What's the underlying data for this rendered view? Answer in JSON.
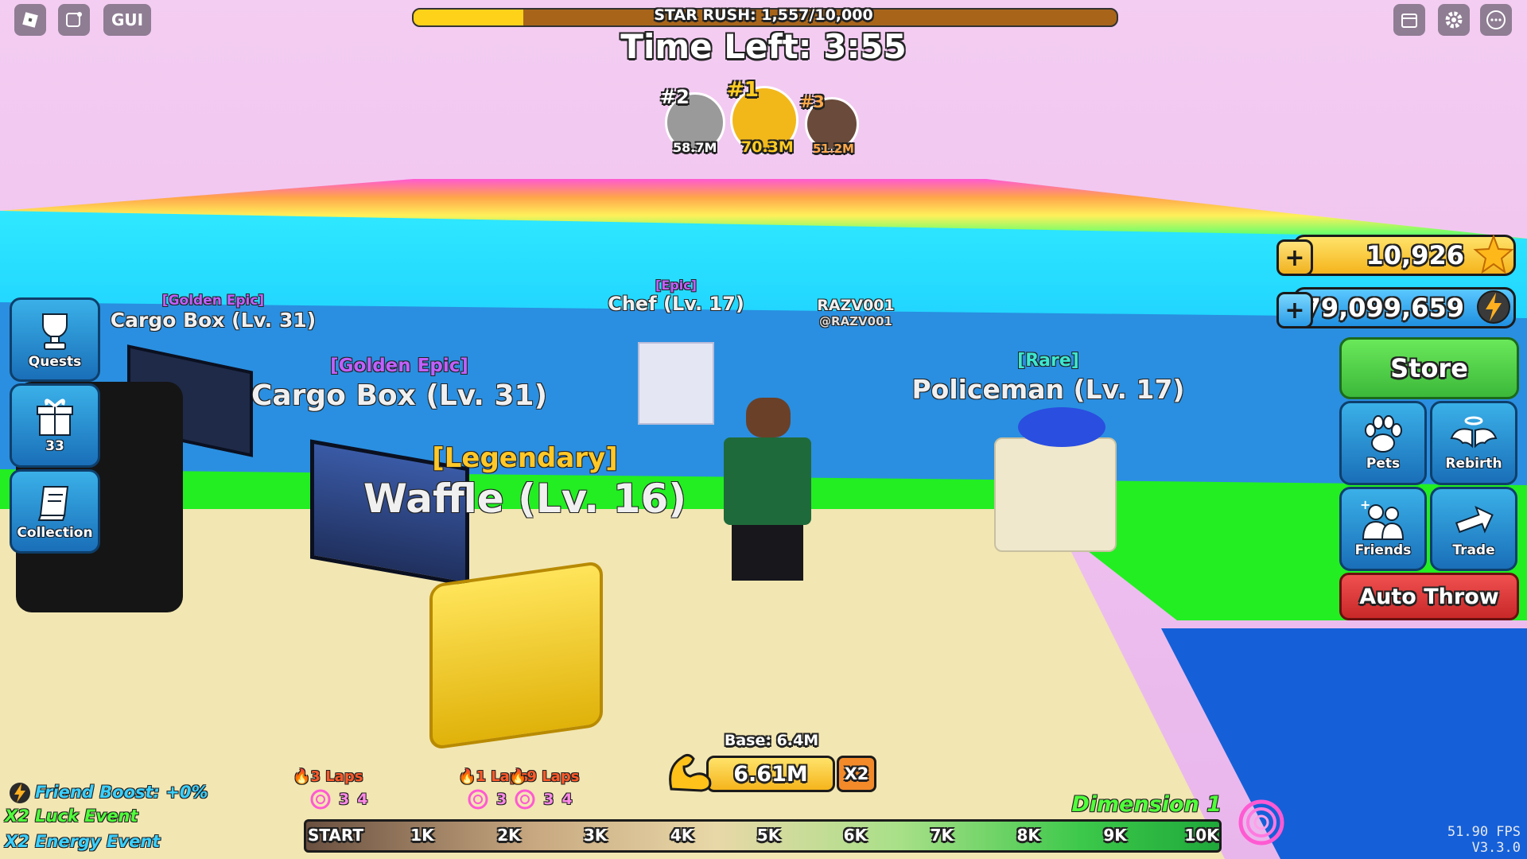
{
  "topbar": {
    "gui_label": "GUI",
    "star_rush": {
      "label": "STAR RUSH: 1,557/10,000",
      "progress": 0.1557
    },
    "time_left": "Time Left: 3:55"
  },
  "leaderboard": [
    {
      "rank": "#2",
      "value": "58.7M"
    },
    {
      "rank": "#1",
      "value": "70.3M"
    },
    {
      "rank": "#3",
      "value": "51.2M"
    }
  ],
  "sidebar": {
    "quests_label": "Quests",
    "gifts_count": "33",
    "collection_label": "Collection"
  },
  "currencies": {
    "stars": "10,926",
    "energy": "179,099,659"
  },
  "menu": {
    "store": "Store",
    "pets": "Pets",
    "rebirth": "Rebirth",
    "friends": "Friends",
    "trade": "Trade",
    "auto_throw": "Auto Throw"
  },
  "world_labels": {
    "cargo_far_rarity": "[Golden Epic]",
    "cargo_far_name": "Cargo Box (Lv. 31)",
    "chef_rarity": "[Epic]",
    "chef_name": "Chef (Lv. 17)",
    "player_name": "RAZV001",
    "player_handle": "@RAZV001",
    "cargo_near_rarity": "[Golden Epic]",
    "cargo_near_name": "Cargo Box (Lv. 31)",
    "police_rarity": "[Rare]",
    "police_name": "Policeman (Lv. 17)",
    "waffle_rarity": "[Legendary]",
    "waffle_name": "Waffle (Lv. 16)"
  },
  "strength": {
    "base": "Base: 6.4M",
    "value": "6.61M",
    "multiplier": "X2"
  },
  "events": {
    "friend_boost": "Friend Boost: +0%",
    "luck": "X2 Luck Event",
    "energy": "X2 Energy Event"
  },
  "dimension": "Dimension 1",
  "track": {
    "markers": [
      "START",
      "1K",
      "2K",
      "3K",
      "4K",
      "5K",
      "6K",
      "7K",
      "8K",
      "9K",
      "10K"
    ],
    "laps_a": "3 Laps",
    "laps_b": "1 Laps",
    "laps_c": "9 Laps",
    "counts_a": [
      "3",
      "4"
    ],
    "counts_b": [
      "3",
      "3",
      "4"
    ]
  },
  "stats": {
    "fps": "51.90 FPS",
    "version": "V3.3.0"
  },
  "colors": {
    "sky": "#f0c8ee",
    "accent_blue": "#2a8fe0",
    "store_green": "#4fd14a",
    "auto_throw_red": "#e23a3a",
    "star_gold": "#ffc83a"
  }
}
